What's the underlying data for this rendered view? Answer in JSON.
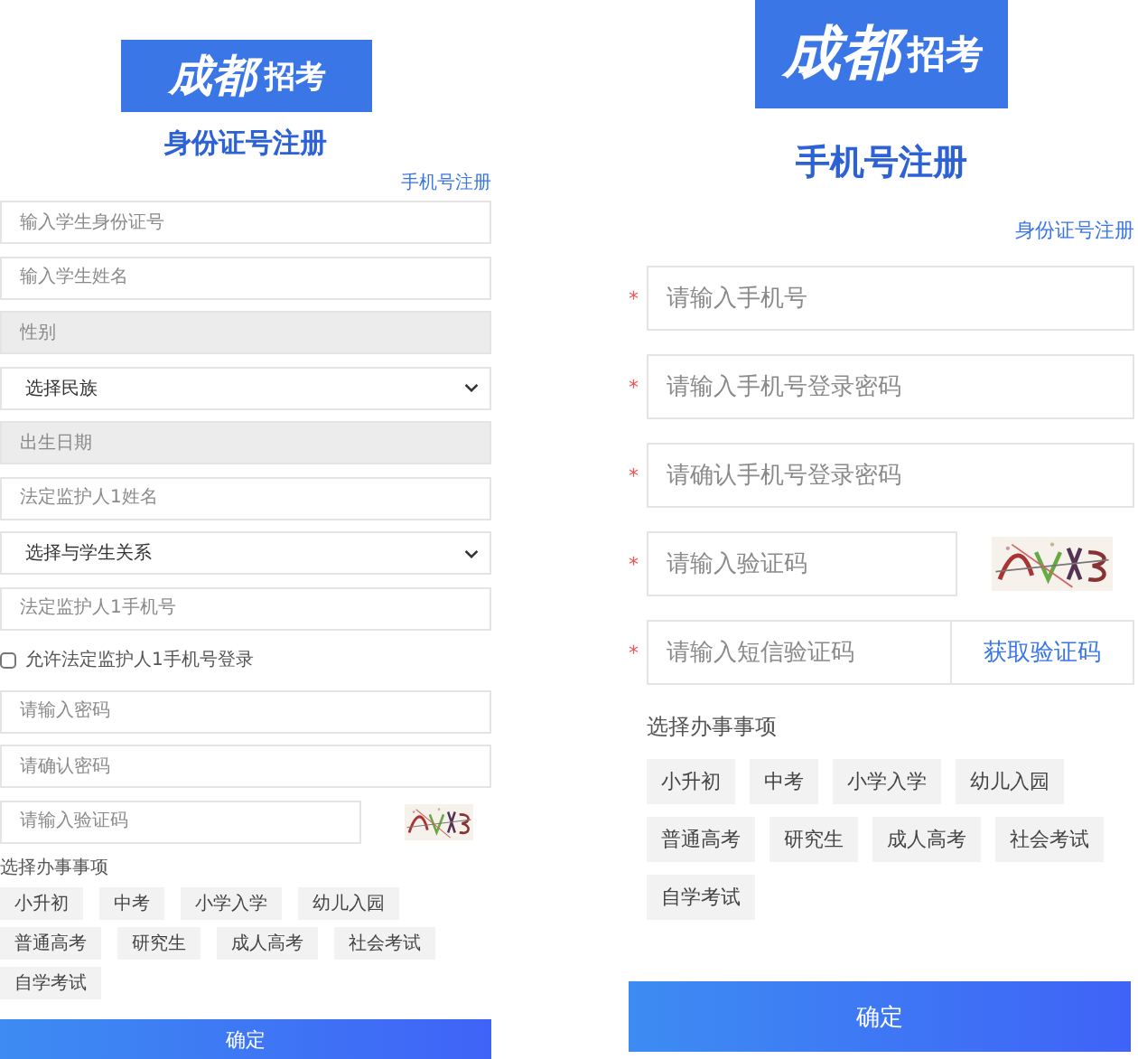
{
  "panels": [
    {
      "kind": "compact",
      "logo": {
        "script": "成都",
        "text": "招考"
      },
      "title": "身份证号注册",
      "switch_link": "手机号注册",
      "fields": [
        {
          "kind": "input",
          "placeholder": "输入学生身份证号",
          "disabled": false
        },
        {
          "kind": "input",
          "placeholder": "输入学生姓名",
          "disabled": false
        },
        {
          "kind": "input",
          "placeholder": "性别",
          "disabled": true
        },
        {
          "kind": "select",
          "value": "选择民族"
        },
        {
          "kind": "input",
          "placeholder": "出生日期",
          "disabled": true
        },
        {
          "kind": "input",
          "placeholder": "法定监护人1姓名",
          "disabled": false
        },
        {
          "kind": "select",
          "value": "选择与学生关系"
        },
        {
          "kind": "input",
          "placeholder": "法定监护人1手机号",
          "disabled": false
        },
        {
          "kind": "checkbox",
          "label": "允许法定监护人1手机号登录",
          "checked": false
        },
        {
          "kind": "input",
          "placeholder": "请输入密码",
          "disabled": false
        },
        {
          "kind": "input",
          "placeholder": "请确认密码",
          "disabled": false
        },
        {
          "kind": "captcha",
          "placeholder": "请输入验证码"
        }
      ],
      "matters_label": "选择办事事项",
      "matters": [
        "小升初",
        "中考",
        "小学入学",
        "幼儿入园",
        "普通高考",
        "研究生",
        "成人高考",
        "社会考试",
        "自学考试"
      ],
      "submit": "确定"
    },
    {
      "kind": "wide",
      "logo": {
        "script": "成都",
        "text": "招考"
      },
      "title": "手机号注册",
      "switch_link": "身份证号注册",
      "fields": [
        {
          "kind": "input",
          "marker": "*",
          "placeholder": "请输入手机号",
          "disabled": false
        },
        {
          "kind": "input",
          "marker": "*",
          "placeholder": "请输入手机号登录密码",
          "disabled": false
        },
        {
          "kind": "input",
          "marker": "*",
          "placeholder": "请确认手机号登录密码",
          "disabled": false
        },
        {
          "kind": "captcha",
          "marker": "*",
          "placeholder": "请输入验证码"
        },
        {
          "kind": "sms",
          "marker": "*",
          "placeholder": "请输入短信验证码",
          "button": "获取验证码"
        }
      ],
      "matters_label": "选择办事事项",
      "matters": [
        "小升初",
        "中考",
        "小学入学",
        "幼儿入园",
        "普通高考",
        "研究生",
        "成人高考",
        "社会考试",
        "自学考试"
      ],
      "submit": "确定"
    }
  ]
}
